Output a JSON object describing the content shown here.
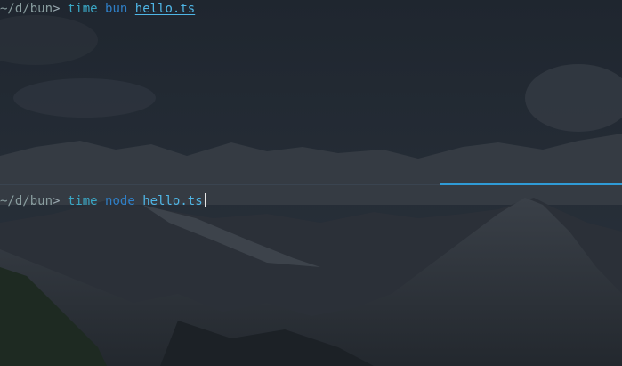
{
  "terminal": {
    "top_pane": {
      "prompt_cwd": "~/d/bun",
      "prompt_symbol": ">",
      "command": "time",
      "argument": "bun",
      "file": "hello.ts"
    },
    "bottom_pane": {
      "prompt_cwd": "~/d/bun",
      "prompt_symbol": ">",
      "command": "time",
      "argument": "node",
      "file": "hello.ts"
    }
  },
  "colors": {
    "cwd": "#8a9ea0",
    "command": "#3aa6c4",
    "argument": "#2f7fc7",
    "file": "#4fb6e6",
    "active_divider": "#2f9bd6"
  },
  "background": "mountain-landscape-wallpaper"
}
